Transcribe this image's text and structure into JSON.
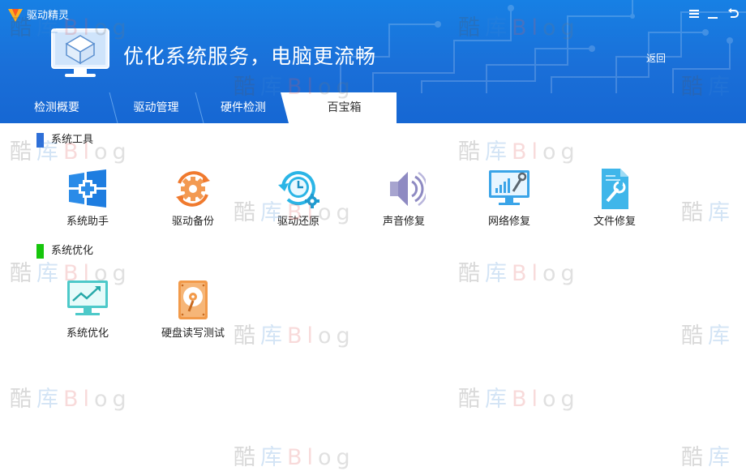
{
  "app": {
    "title": "驱动精灵",
    "banner_text": "优化系统服务，电脑更流畅",
    "back_label": "返回"
  },
  "tabs": [
    {
      "label": "检测概要"
    },
    {
      "label": "驱动管理"
    },
    {
      "label": "硬件检测"
    },
    {
      "label": "百宝箱",
      "active": true
    }
  ],
  "sections": [
    {
      "title": "系统工具",
      "accent": "#2e6fd8",
      "items": [
        {
          "label": "系统助手",
          "icon": "windows-plus-icon"
        },
        {
          "label": "驱动备份",
          "icon": "gear-cycle-icon"
        },
        {
          "label": "驱动还原",
          "icon": "clock-restore-icon"
        },
        {
          "label": "声音修复",
          "icon": "speaker-icon"
        },
        {
          "label": "网络修复",
          "icon": "monitor-wrench-icon"
        },
        {
          "label": "文件修复",
          "icon": "file-wrench-icon"
        }
      ]
    },
    {
      "title": "系统优化",
      "accent": "#16c60c",
      "items": [
        {
          "label": "系统优化",
          "icon": "monitor-chart-icon"
        },
        {
          "label": "硬盘读写测试",
          "icon": "hard-disk-icon"
        }
      ]
    }
  ],
  "watermark": {
    "part1": "酷",
    "part2": "库",
    "part3": "Bl",
    "part4": "og"
  },
  "colors": {
    "header": "#1a6fd8",
    "tab_active_bg": "#ffffff",
    "icon_blue": "#1e88e5",
    "icon_orange": "#f07a2e",
    "icon_cyan": "#2bb5e6"
  }
}
